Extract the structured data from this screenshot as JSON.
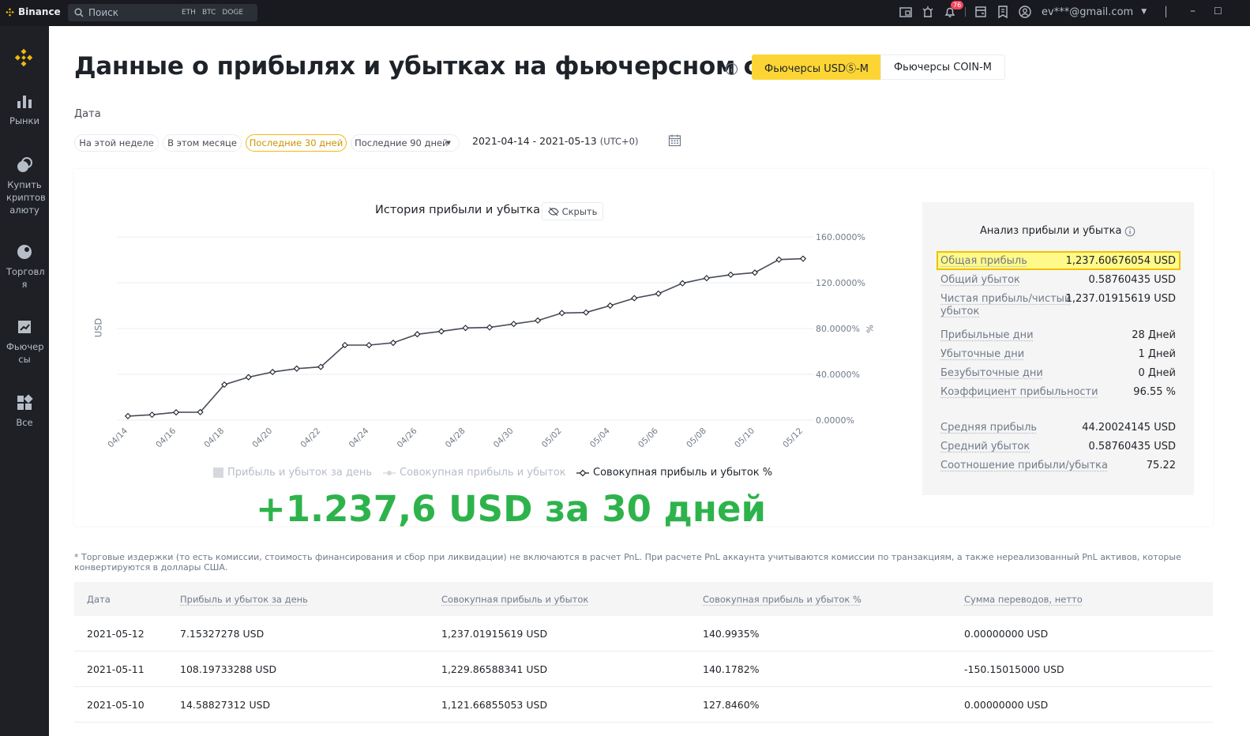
{
  "titlebar": {
    "brand": "Binance",
    "search_placeholder": "Поиск",
    "quick_coins": [
      "ETH",
      "BTC",
      "DOGE"
    ],
    "notification_count": "76",
    "account": "ev***@gmail.com"
  },
  "sidebar": {
    "items": [
      {
        "label": "Рынки",
        "icon": "bar-chart-icon"
      },
      {
        "label": "Купить криптов алюту",
        "icon": "coins-icon"
      },
      {
        "label": "Торговл я",
        "icon": "trade-icon"
      },
      {
        "label": "Фьючер сы",
        "icon": "futures-icon"
      },
      {
        "label": "Все",
        "icon": "grid-icon"
      }
    ]
  },
  "header": {
    "title": "Данные о прибылях и убытках на фьючерсном счете",
    "tab_usd": "Фьючерсы USDⓈ-M",
    "tab_coin": "Фьючерсы COIN-M"
  },
  "filters": {
    "label": "Дата",
    "week": "На этой неделе",
    "month": "В этом месяце",
    "last30": "Последние 30 дней",
    "last90": "Последние 90 дней",
    "date_range": "2021-04-14 - 2021-05-13",
    "timezone": "(UTC+0)"
  },
  "chart_header": {
    "title": "История прибыли и убытка",
    "hide_label": "Скрыть",
    "ylabel": "USD",
    "y2label": "%"
  },
  "chart_data": {
    "type": "line",
    "x": [
      "04/14",
      "04/15",
      "04/16",
      "04/17",
      "04/18",
      "04/19",
      "04/20",
      "04/21",
      "04/22",
      "04/23",
      "04/24",
      "04/25",
      "04/26",
      "04/27",
      "04/28",
      "04/29",
      "04/30",
      "05/01",
      "05/02",
      "05/03",
      "05/04",
      "05/05",
      "05/06",
      "05/07",
      "05/08",
      "05/09",
      "05/10",
      "05/11",
      "05/12"
    ],
    "xtick_labels": [
      "04/14",
      "04/16",
      "04/18",
      "04/20",
      "04/22",
      "04/24",
      "04/26",
      "04/28",
      "04/30",
      "05/02",
      "05/04",
      "05/06",
      "05/08",
      "05/10",
      "05/12"
    ],
    "series": [
      {
        "name": "Совокупная прибыль и убыток %",
        "values": [
          3.5,
          4.7,
          6.8,
          7.0,
          31.0,
          37.5,
          42.0,
          45.0,
          46.5,
          65.5,
          65.5,
          67.5,
          75.0,
          77.5,
          80.5,
          81.0,
          84.0,
          87.0,
          93.5,
          94.0,
          100.0,
          106.5,
          110.5,
          119.5,
          124.0,
          127.0,
          128.8,
          140.2,
          141.0
        ]
      }
    ],
    "y2ticks": [
      "0.0000%",
      "40.0000%",
      "80.0000%",
      "120.0000%",
      "160.0000%"
    ],
    "ylim": [
      0,
      160
    ],
    "legend": [
      "Прибыль и убыток за день",
      "Совокупная прибыль и убыток",
      "Совокупная прибыль и убыток %"
    ],
    "legend_position": "bottom",
    "grid": true,
    "line_color": "#474d57"
  },
  "promo_text": "+1.237,6 USD за 30 дней",
  "analysis": {
    "title": "Анализ прибыли и убытка",
    "rows": [
      {
        "label": "Общая прибыль",
        "value": "1,237.60676054 USD"
      },
      {
        "label": "Общий убыток",
        "value": "0.58760435 USD"
      },
      {
        "label": "Чистая прибыль/чистый убыток",
        "value": "1,237.01915619 USD"
      },
      {
        "label": "Прибыльные дни",
        "value": "28 Дней"
      },
      {
        "label": "Убыточные дни",
        "value": "1 Дней"
      },
      {
        "label": "Безубыточные дни",
        "value": "0 Дней"
      },
      {
        "label": "Коэффициент прибыльности",
        "value": "96.55 %"
      },
      {
        "label": "Средняя прибыль",
        "value": "44.20024145 USD"
      },
      {
        "label": "Средний убыток",
        "value": "0.58760435 USD"
      },
      {
        "label": "Соотношение прибыли/убытка",
        "value": "75.22"
      }
    ]
  },
  "note": "* Торговые издержки (то есть комиссии, стоимость финансирования и сбор при ликвидации) не включаются в расчет PnL. При расчете PnL аккаунта учитываются комиссии по транзакциям, а также нереализованный PnL активов, которые конвертируются в доллары США.",
  "table": {
    "headers": [
      "Дата",
      "Прибыль и убыток за день",
      "Совокупная прибыль и убыток",
      "Совокупная прибыль и убыток %",
      "Сумма переводов, нетто"
    ],
    "rows": [
      [
        "2021-05-12",
        "7.15327278 USD",
        "1,237.01915619 USD",
        "140.9935%",
        "0.00000000 USD"
      ],
      [
        "2021-05-11",
        "108.19733288 USD",
        "1,229.86588341 USD",
        "140.1782%",
        "-150.15015000 USD"
      ],
      [
        "2021-05-10",
        "14.58827312 USD",
        "1,121.66855053 USD",
        "127.8460%",
        "0.00000000 USD"
      ]
    ]
  },
  "colors": {
    "accent": "#fcd535",
    "promo": "#2eb34c",
    "highlight": "#fff98a"
  }
}
